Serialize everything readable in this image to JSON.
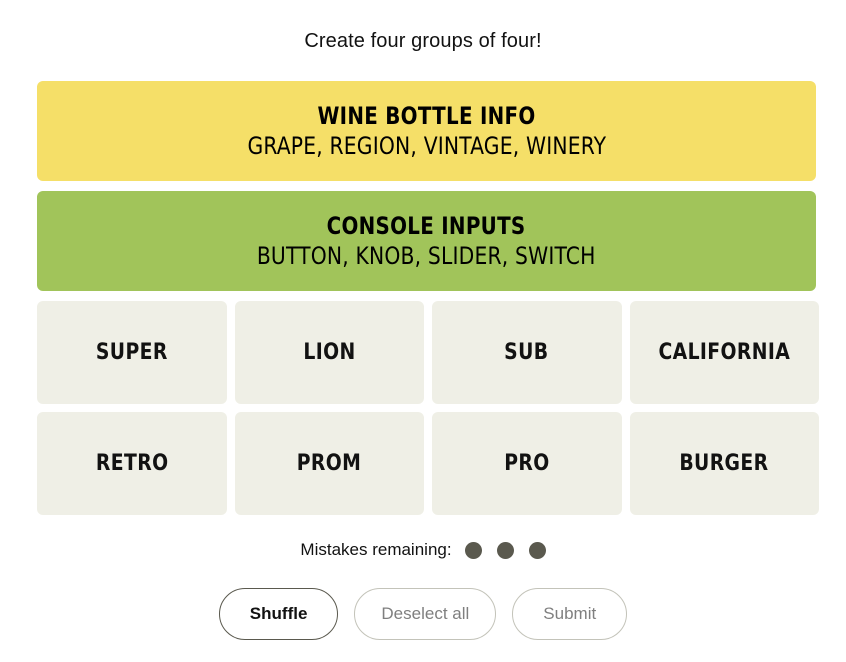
{
  "header": {
    "instruction": "Create four groups of four!"
  },
  "solved_groups": [
    {
      "title": "WINE BOTTLE INFO",
      "members": "GRAPE, REGION, VINTAGE, WINERY",
      "color": "#f5df68"
    },
    {
      "title": "CONSOLE INPUTS",
      "members": "BUTTON, KNOB, SLIDER, SWITCH",
      "color": "#a1c45a"
    }
  ],
  "tiles": [
    {
      "label": "SUPER"
    },
    {
      "label": "LION"
    },
    {
      "label": "SUB"
    },
    {
      "label": "CALIFORNIA"
    },
    {
      "label": "RETRO"
    },
    {
      "label": "PROM"
    },
    {
      "label": "PRO"
    },
    {
      "label": "BURGER"
    }
  ],
  "mistakes": {
    "label": "Mistakes remaining:",
    "remaining": 3,
    "dot_color": "#5a594e"
  },
  "controls": {
    "shuffle_label": "Shuffle",
    "deselect_label": "Deselect all",
    "submit_label": "Submit",
    "shuffle_enabled": true,
    "deselect_enabled": false,
    "submit_enabled": false
  },
  "theme": {
    "page_background": "#ffffff",
    "tile_background": "#efefe6",
    "text_color": "#121212",
    "disabled_text": "#7f7f7f",
    "border_color": "#5a594e"
  }
}
